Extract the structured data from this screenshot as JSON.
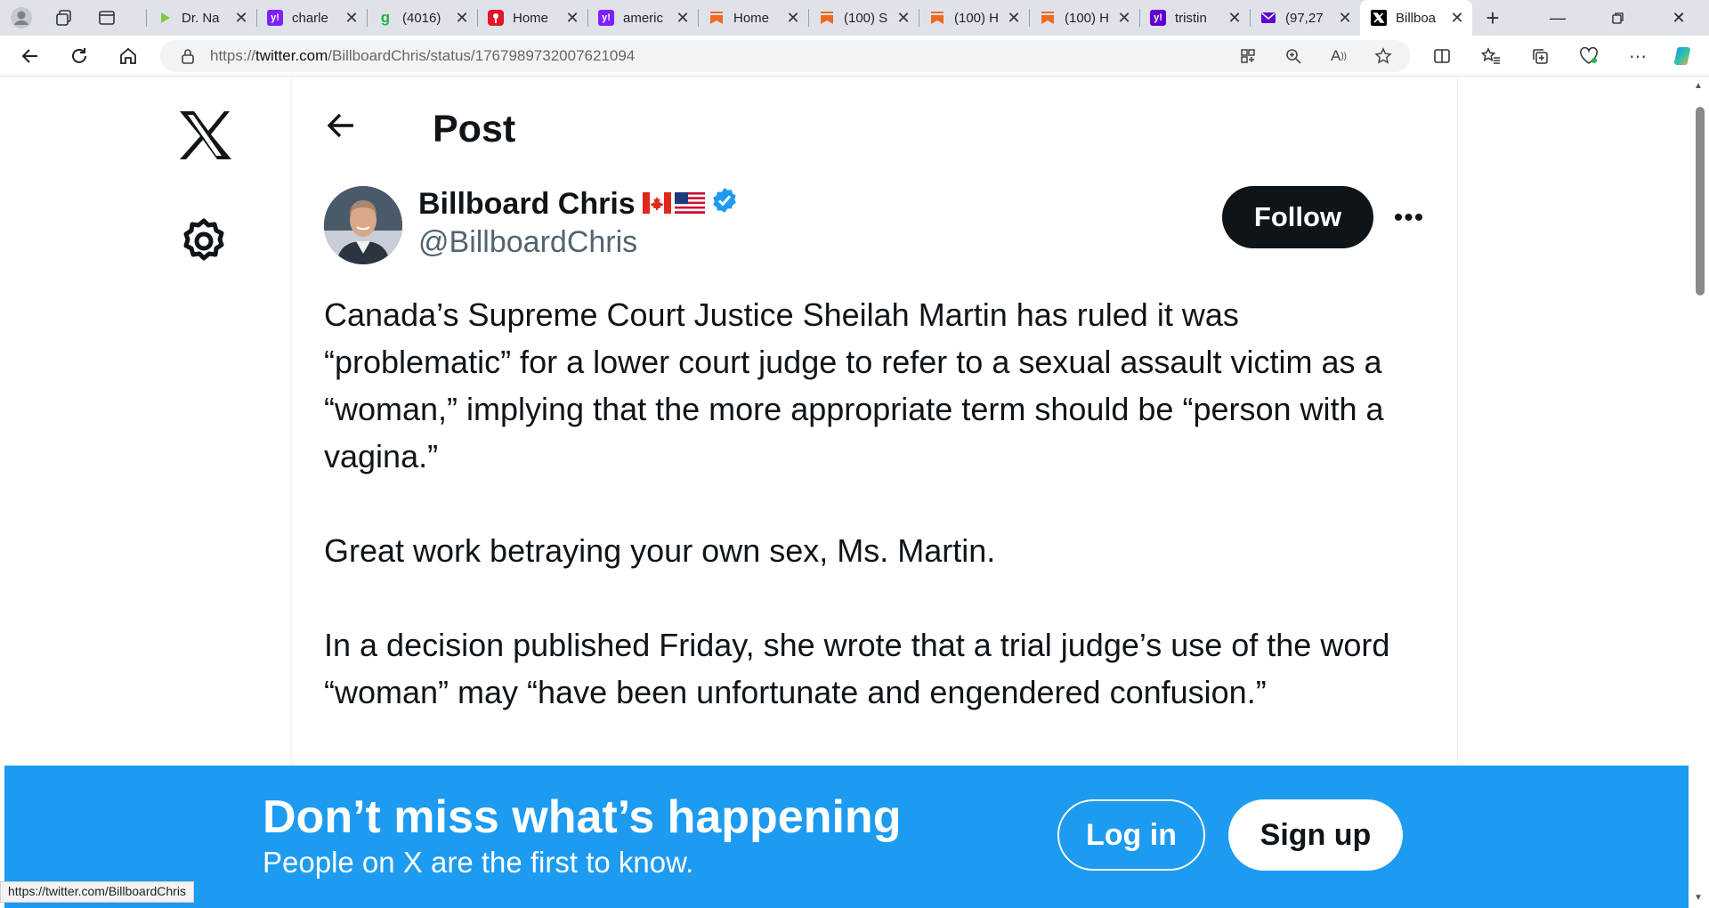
{
  "tabs": [
    {
      "title": "Dr. Na",
      "favicon": "rumble",
      "color": "#85c742"
    },
    {
      "title": "charle",
      "favicon": "yahoo",
      "color": "#7e1fff"
    },
    {
      "title": "(4016)",
      "favicon": "g-green",
      "color": "#23b14d"
    },
    {
      "title": "Home",
      "favicon": "red-badge",
      "color": "#e0162b"
    },
    {
      "title": "americ",
      "favicon": "yahoo",
      "color": "#7e1fff"
    },
    {
      "title": "Home",
      "favicon": "bookmark-orange",
      "color": "#ef6a24"
    },
    {
      "title": "(100) S",
      "favicon": "bookmark-orange",
      "color": "#ef6a24"
    },
    {
      "title": "(100) H",
      "favicon": "bookmark-orange",
      "color": "#ef6a24"
    },
    {
      "title": "(100) H",
      "favicon": "bookmark-orange",
      "color": "#ef6a24"
    },
    {
      "title": "tristin",
      "favicon": "yahoo",
      "color": "#5f01d1"
    },
    {
      "title": "(97,27",
      "favicon": "mail",
      "color": "#6001d2"
    },
    {
      "title": "Billboa",
      "favicon": "x",
      "color": "#000000",
      "active": true
    }
  ],
  "address": {
    "prefix": "https://",
    "domain": "twitter.com",
    "path": "/BillboardChris/status/1767989732007621094"
  },
  "header": {
    "title": "Post"
  },
  "tweet": {
    "name": "Billboard Chris",
    "flags": [
      "canada-flag-icon",
      "usa-flag-icon"
    ],
    "handle": "@BillboardChris",
    "follow_label": "Follow",
    "paragraphs": [
      "Canada’s Supreme Court Justice Sheilah Martin has ruled it was “problematic” for a lower court judge to refer to a sexual assault victim as a “woman,” implying that the more appropriate term should be “person with a vagina.”",
      "Great work betraying your own sex, Ms. Martin.",
      "In a decision published Friday, she wrote that a trial judge’s use of the word “woman” may “have been unfortunate and engendered confusion.”"
    ]
  },
  "banner": {
    "title": "Don’t miss what’s happening",
    "subtitle": "People on X are the first to know.",
    "login_label": "Log in",
    "signup_label": "Sign up"
  },
  "status_url": "https://twitter.com/BillboardChris",
  "colors": {
    "accent": "#1d9bf0",
    "button_dark": "#0f1419",
    "secondary_text": "#536471"
  }
}
